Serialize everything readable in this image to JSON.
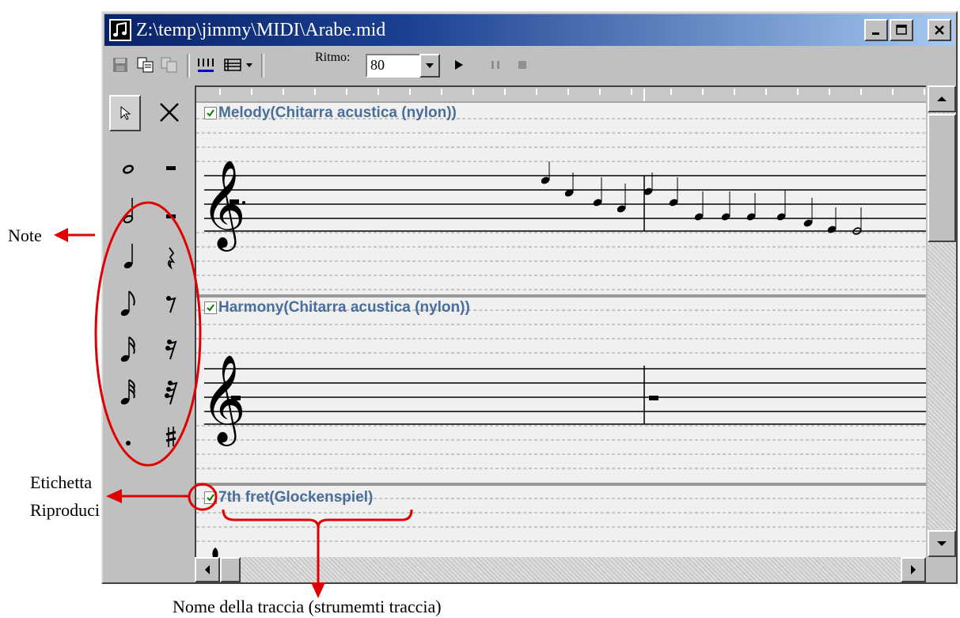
{
  "window": {
    "title": "Z:\\temp\\jimmy\\MIDI\\Arabe.mid"
  },
  "titlebar_buttons": [
    "minimize-icon",
    "maximize-icon",
    "close-icon"
  ],
  "toolbar": {
    "tempo_label": "Ritmo:",
    "tempo_value": "80",
    "icons": [
      "save-icon",
      "copy-icon",
      "paste-icon",
      "tracks-icon",
      "list-icon",
      "dropdown-icon",
      "play-icon",
      "pause-icon",
      "stop-icon"
    ]
  },
  "palette": {
    "tools": [
      "pointer-icon",
      "delete-icon"
    ],
    "notes": [
      "whole-note-icon",
      "half-note-icon",
      "quarter-note-icon",
      "eighth-note-icon",
      "sixteenth-note-icon",
      "thirty-second-note-icon",
      "dot-icon"
    ],
    "rests": [
      "whole-rest-icon",
      "half-rest-icon",
      "quarter-rest-icon",
      "eighth-rest-icon",
      "sixteenth-rest-icon",
      "thirty-second-rest-icon",
      "sharp-icon"
    ]
  },
  "tracks": [
    {
      "name": "Melody(Chitarra acustica (nylon))",
      "checked": true
    },
    {
      "name": "Harmony(Chitarra acustica (nylon))",
      "checked": true
    },
    {
      "name": "7th fret(Glockenspiel)",
      "checked": true
    }
  ],
  "annotations": {
    "note": "Note",
    "etichetta_line1": "Etichetta",
    "etichetta_line2": "Riproduci",
    "track_name": "Nome della traccia (strumemti traccia)"
  },
  "colors": {
    "titlebar_start": "#0a246a",
    "titlebar_end": "#a6caf0",
    "annotation_red": "#e00000",
    "track_name": "#4a6e9a"
  }
}
